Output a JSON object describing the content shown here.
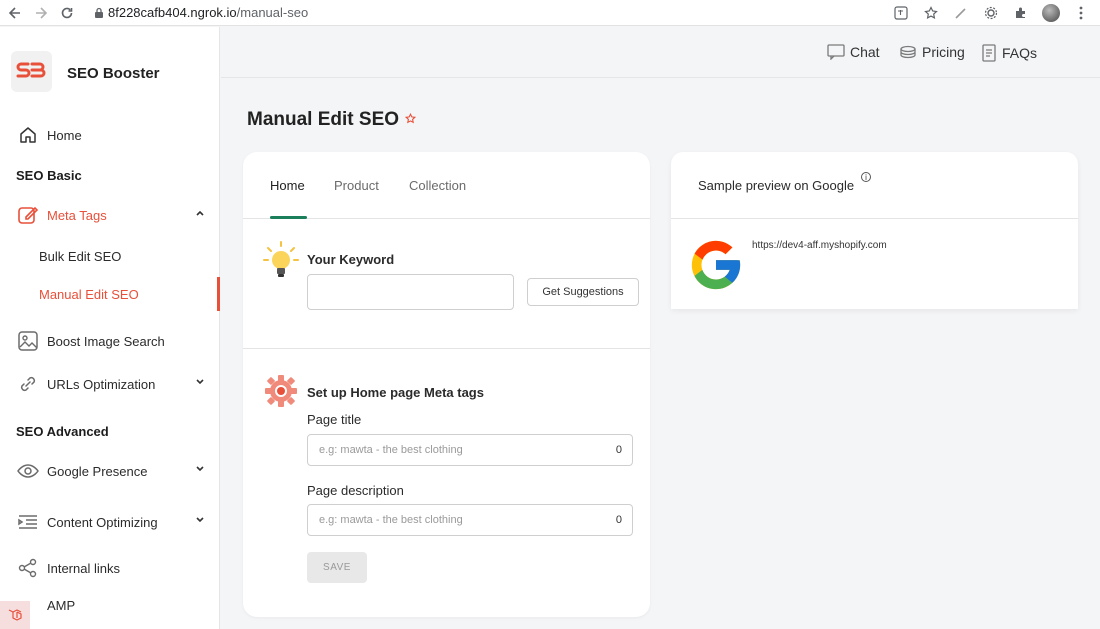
{
  "browser": {
    "url_host": "8f228cafb404.ngrok.io",
    "url_path": "/manual-seo"
  },
  "app": {
    "name": "SEO Booster"
  },
  "sidebar": {
    "home": "Home",
    "section_basic": "SEO Basic",
    "meta_tags": "Meta Tags",
    "bulk_edit": "Bulk Edit SEO",
    "manual_edit": "Manual Edit SEO",
    "boost_image": "Boost Image Search",
    "urls_opt": "URLs Optimization",
    "section_advanced": "SEO Advanced",
    "google_presence": "Google Presence",
    "content_opt": "Content Optimizing",
    "internal_links": "Internal links",
    "amp": "AMP"
  },
  "topnav": {
    "chat": "Chat",
    "pricing": "Pricing",
    "faqs": "FAQs"
  },
  "page": {
    "title": "Manual Edit SEO"
  },
  "tabs": {
    "home": "Home",
    "product": "Product",
    "collection": "Collection"
  },
  "keyword": {
    "label": "Your Keyword",
    "value": "",
    "button": "Get Suggestions"
  },
  "meta": {
    "heading": "Set up Home page Meta tags",
    "title_label": "Page title",
    "title_placeholder": "e.g: mawta - the best clothing",
    "title_count": "0",
    "desc_label": "Page description",
    "desc_placeholder": "e.g: mawta - the best clothing",
    "desc_count": "0",
    "save": "SAVE"
  },
  "preview": {
    "title": "Sample preview on Google",
    "info": "i",
    "url": "https://dev4-aff.myshopify.com"
  },
  "colors": {
    "accent": "#e8503a",
    "tab_active": "#1a7f5a"
  }
}
